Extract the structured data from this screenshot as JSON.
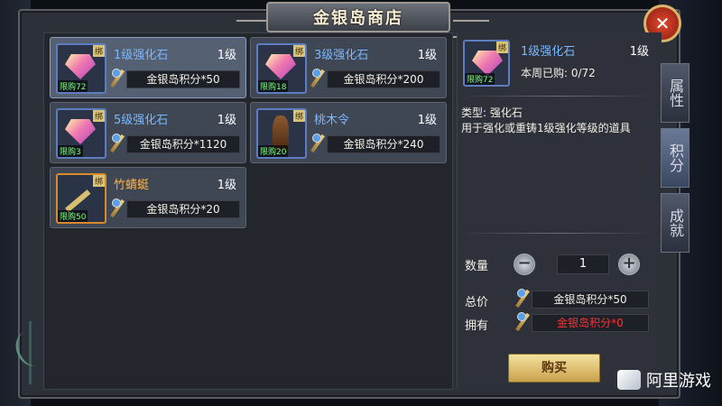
{
  "title": "金银岛商店",
  "close_icon": "close-icon",
  "bind_label": "绑",
  "items": [
    {
      "name": "1级强化石",
      "level": "1级",
      "price": "金银岛积分*50",
      "limit": "限购72",
      "icon": "gem-icon",
      "quality": "blue"
    },
    {
      "name": "3级强化石",
      "level": "1级",
      "price": "金银岛积分*200",
      "limit": "限购18",
      "icon": "gem-icon",
      "quality": "blue"
    },
    {
      "name": "5级强化石",
      "level": "1级",
      "price": "金银岛积分*1120",
      "limit": "限购3",
      "icon": "gem-icon",
      "quality": "blue"
    },
    {
      "name": "桃木令",
      "level": "1级",
      "price": "金银岛积分*240",
      "limit": "限购20",
      "icon": "token-icon",
      "quality": "blue"
    },
    {
      "name": "竹蜻蜓",
      "level": "1级",
      "price": "金银岛积分*20",
      "limit": "限购50",
      "icon": "dragonfly-icon",
      "quality": "orange"
    }
  ],
  "detail": {
    "name": "1级强化石",
    "level": "1级",
    "limit": "限购72",
    "weekly_bought": "本周已购: 0/72",
    "type_line": "类型: 强化石",
    "description": "用于强化或重铸1级强化等级的道具",
    "quantity_label": "数量",
    "quantity": "1",
    "minus": "−",
    "plus": "+",
    "total_label": "总价",
    "total_value": "金银岛积分*50",
    "own_label": "拥有",
    "own_value": "金银岛积分*0",
    "buy_label": "购买"
  },
  "side_tabs": [
    "属性",
    "积分",
    "成就"
  ],
  "watermark": "阿里游戏",
  "colors": {
    "item_blue": "#7ab8ff",
    "item_orange": "#ffb347",
    "limit_green": "#7dff7d",
    "own_red": "#ff3030"
  }
}
